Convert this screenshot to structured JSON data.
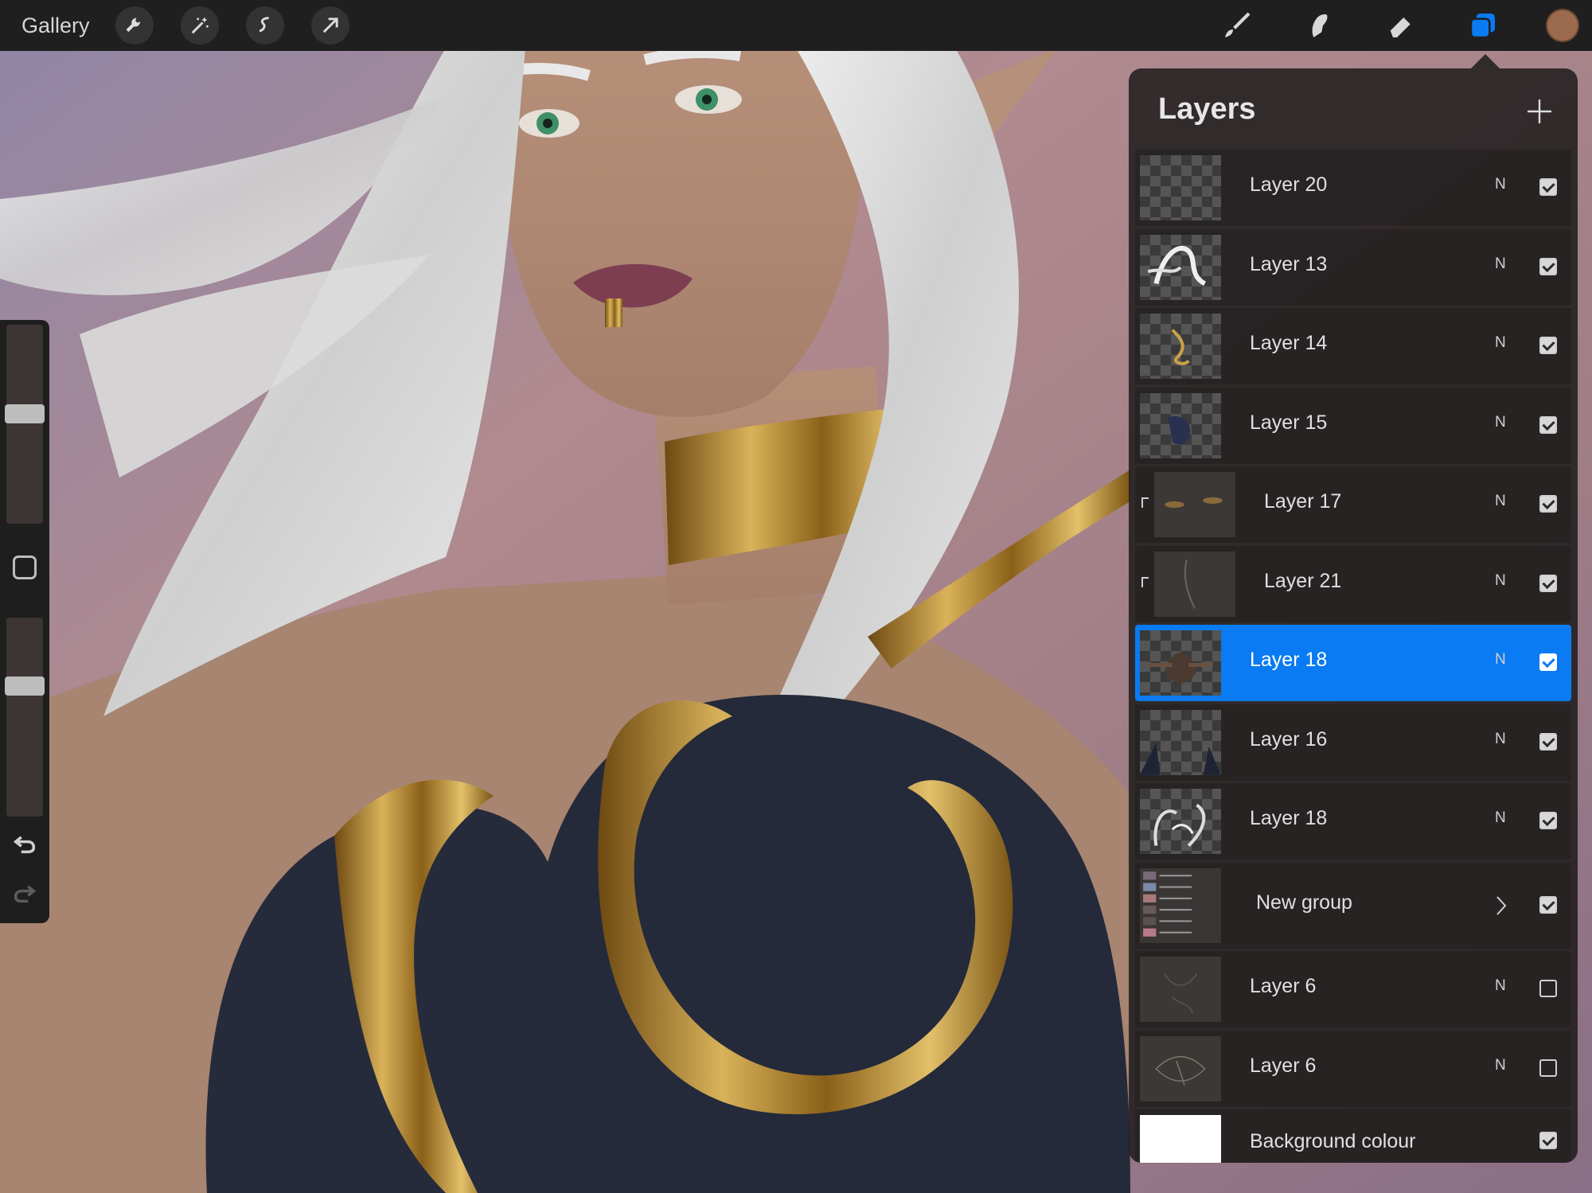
{
  "topbar": {
    "gallery_label": "Gallery",
    "left_tools": [
      "wrench-icon",
      "magic-wand-icon",
      "selection-icon",
      "transform-arrow-icon"
    ],
    "right_tools": [
      "brush-icon",
      "smudge-icon",
      "eraser-icon",
      "layers-icon"
    ],
    "active_tool": "layers-icon",
    "current_color": "#9c6a4c"
  },
  "sidebar": {
    "brush_size_level": 0.47,
    "opacity_level": 0.35,
    "modify_button": "square-icon",
    "undo_icon": "undo-icon",
    "redo_icon": "redo-icon"
  },
  "layers": {
    "title": "Layers",
    "add_icon": "plus-icon",
    "items": [
      {
        "name": "Layer 20",
        "blend": "N",
        "visible": true,
        "clipped": false,
        "selected": false
      },
      {
        "name": "Layer 13",
        "blend": "N",
        "visible": true,
        "clipped": false,
        "selected": false
      },
      {
        "name": "Layer 14",
        "blend": "N",
        "visible": true,
        "clipped": false,
        "selected": false
      },
      {
        "name": "Layer 15",
        "blend": "N",
        "visible": true,
        "clipped": false,
        "selected": false
      },
      {
        "name": "Layer 17",
        "blend": "N",
        "visible": true,
        "clipped": true,
        "selected": false
      },
      {
        "name": "Layer 21",
        "blend": "N",
        "visible": true,
        "clipped": true,
        "selected": false
      },
      {
        "name": "Layer 18",
        "blend": "N",
        "visible": true,
        "clipped": false,
        "selected": true
      },
      {
        "name": "Layer 16",
        "blend": "N",
        "visible": true,
        "clipped": false,
        "selected": false
      },
      {
        "name": "Layer 18",
        "blend": "N",
        "visible": true,
        "clipped": false,
        "selected": false
      },
      {
        "name": "New group",
        "blend": "",
        "visible": true,
        "clipped": false,
        "selected": false,
        "group": true
      },
      {
        "name": "Layer 6",
        "blend": "N",
        "visible": false,
        "clipped": false,
        "selected": false
      },
      {
        "name": "Layer 6",
        "blend": "N",
        "visible": false,
        "clipped": false,
        "selected": false
      },
      {
        "name": "Background colour",
        "blend": "",
        "visible": true,
        "clipped": false,
        "selected": false,
        "background": true
      }
    ]
  },
  "colors": {
    "accent": "#0a7bf2",
    "toolbar": "#1f1f1f"
  }
}
